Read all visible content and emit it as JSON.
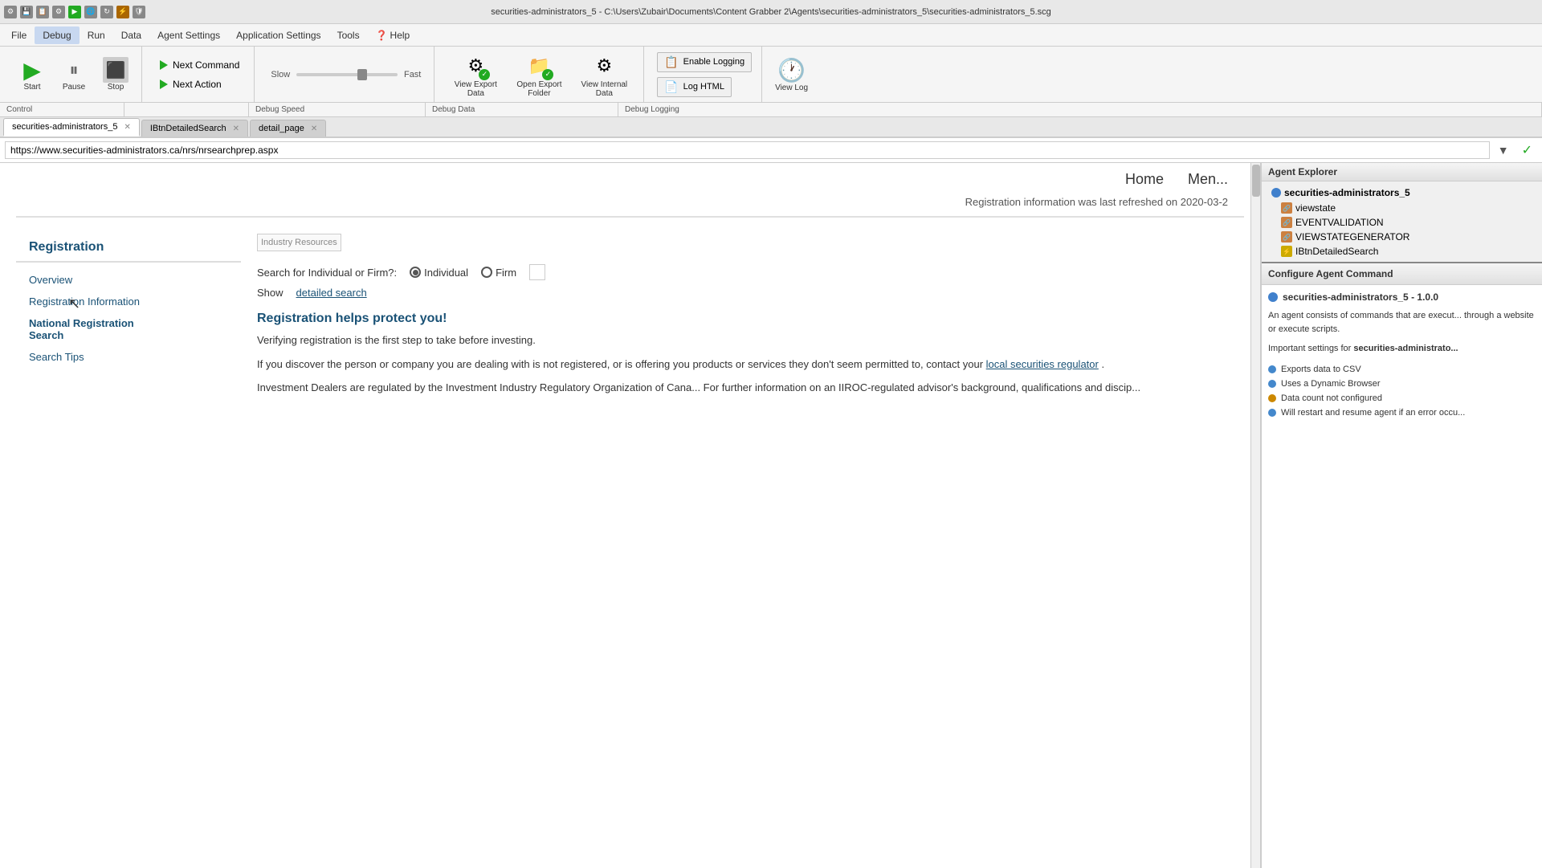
{
  "titlebar": {
    "title": "securities-administrators_5 - C:\\Users\\Zubair\\Documents\\Content Grabber 2\\Agents\\securities-administrators_5\\securities-administrators_5.scg"
  },
  "menu": {
    "items": [
      "File",
      "Debug",
      "Run",
      "Data",
      "Agent Settings",
      "Application Settings",
      "Tools",
      "Help"
    ],
    "active": "Debug",
    "help_icon": "❓"
  },
  "toolbar": {
    "start_label": "Start",
    "pause_label": "Pause",
    "stop_label": "Stop",
    "next_command_label": "Next Command",
    "next_action_label": "Next Action",
    "speed_slow": "Slow",
    "speed_fast": "Fast",
    "debug_speed_label": "Debug Speed",
    "view_export_data_label": "View Export\nData",
    "open_export_folder_label": "Open Export\nFolder",
    "view_internal_data_label": "View Internal\nData",
    "debug_data_label": "Debug Data",
    "enable_logging_label": "Enable Logging",
    "log_html_label": "Log HTML",
    "view_log_label": "View Log",
    "debug_logging_label": "Debug Logging",
    "control_label": "Control"
  },
  "tabs": [
    {
      "label": "securities-administrators_5",
      "active": true
    },
    {
      "label": "IBtnDetailedSearch",
      "active": false
    },
    {
      "label": "detail_page",
      "active": false
    }
  ],
  "url_bar": {
    "url": "https://www.securities-administrators.ca/nrs/nrsearchprep.aspx"
  },
  "webpage": {
    "nav_links": [
      "Home",
      "Men..."
    ],
    "refresh_notice": "Registration information was last refreshed on 2020-03-2",
    "left_nav": {
      "title": "Registration",
      "items": [
        {
          "label": "Overview",
          "bold": false
        },
        {
          "label": "Registration Information",
          "bold": false
        },
        {
          "label": "National Registration\nSearch",
          "bold": true
        },
        {
          "label": "Search Tips",
          "bold": false
        }
      ]
    },
    "industry_resources": "Industry Resources",
    "search_label": "Search for Individual or Firm?:",
    "individual_label": "Individual",
    "firm_label": "Firm",
    "show_label": "Show",
    "detailed_search_link": "detailed search",
    "section_title": "Registration helps protect you!",
    "para1": "Verifying registration is the first step to take before investing.",
    "para2": "If you discover the person or company you are dealing with is not registered, or is offering you products or services they don't seem permitted to, contact your",
    "para2_link": "local securities regulator",
    "para2_end": ".",
    "para3": "Investment Dealers are regulated by the Investment Industry Regulatory Organization of Cana... For further information on an IIROC-regulated advisor's background, qualifications and discip..."
  },
  "agent_explorer": {
    "title": "Agent Explorer",
    "root": "securities-administrators_5",
    "items": [
      {
        "label": "viewstate",
        "type": "chain"
      },
      {
        "label": "EVENTVALIDATION",
        "type": "chain"
      },
      {
        "label": "VIEWSTATEGENERATOR",
        "type": "chain"
      },
      {
        "label": "IBtnDetailedSearch",
        "type": "yellow"
      }
    ]
  },
  "config_panel": {
    "title": "Configure Agent Command",
    "agent_name": "securities-administrators_5 - 1.0.0",
    "desc1": "An agent consists of commands that are execut... through a website or execute scripts.",
    "desc2_prefix": "Important settings for ",
    "desc2_bold": "securities-administrato...",
    "bullets": [
      {
        "text": "Exports data to CSV",
        "type": "blue"
      },
      {
        "text": "Uses a Dynamic Browser",
        "type": "blue"
      },
      {
        "text": "Data count not configured",
        "type": "yellow"
      },
      {
        "text": "Will restart and resume agent if an error occu...",
        "type": "blue"
      }
    ]
  }
}
